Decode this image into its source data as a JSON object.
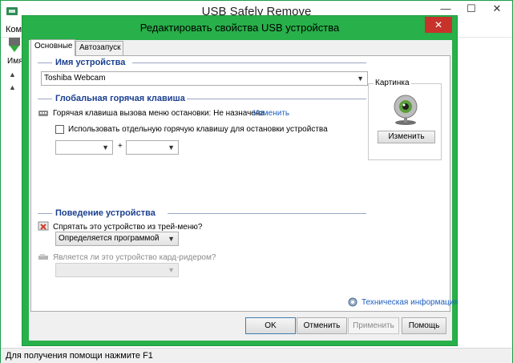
{
  "main_window": {
    "title": "USB Safely Remove",
    "menu_fragment": "Ком",
    "list_header_fragment": "Имя",
    "status_text": "Для получения помощи нажмите F1"
  },
  "dialog": {
    "title": "Редактировать свойства USB устройства",
    "close_glyph": "✕",
    "tabs": [
      {
        "label": "Основные",
        "active": true
      },
      {
        "label": "Автозапуск",
        "active": false
      }
    ],
    "device_name_section": {
      "title": "Имя устройства",
      "value": "Toshiba Webcam"
    },
    "hotkey_section": {
      "title": "Глобальная горячая клавиша",
      "label": "Горячая клавиша вызова меню остановки: Не назначена",
      "change_link": "Изменить",
      "separate_hotkey_checkbox": {
        "label": "Использовать отдельную горячую клавишу для остановки устройства",
        "checked": false
      },
      "key1_value": "",
      "plus": "+",
      "key2_value": ""
    },
    "behavior_section": {
      "title": "Поведение устройства",
      "hide_label": "Спрятать это устройство из трей-меню?",
      "hide_value": "Определяется программой",
      "cardreader_label": "Является ли это устройство кард-ридером?",
      "cardreader_value": ""
    },
    "picture_group": {
      "title": "Картинка",
      "change_button": "Изменить"
    },
    "tech_info_link": "Техническая информация",
    "buttons": {
      "ok": "OK",
      "cancel": "Отменить",
      "apply": "Применить",
      "help": "Помощь"
    }
  },
  "colors": {
    "dialog_frame": "#28b04a",
    "close_button": "#c7332b",
    "section_title": "#1a3f8f",
    "link": "#1c5ec2"
  }
}
